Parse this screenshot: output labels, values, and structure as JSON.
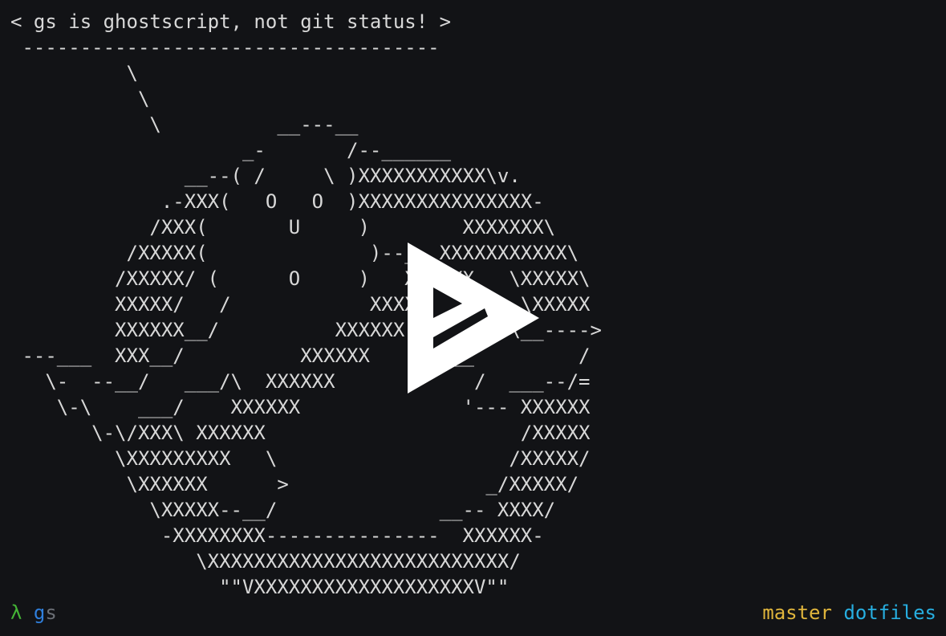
{
  "terminal": {
    "lines": [
      "< gs is ghostscript, not git status! >",
      " ------------------------------------",
      "          \\",
      "           \\",
      "            \\          __---__",
      "                    _-       /--______",
      "               __--( /     \\ )XXXXXXXXXXX\\v.",
      "             .-XXX(   O   O  )XXXXXXXXXXXXXXX-",
      "            /XXX(       U     )        XXXXXXX\\",
      "          /XXXXX(              )--_  XXXXXXXXXXX\\",
      "         /XXXXX/ (      O     )   XXXXXX   \\XXXXX\\",
      "         XXXXX/   /            XXXXXX   \\__ \\XXXXX",
      "         XXXXXX__/          XXXXXX         \\__---->",
      " ---___  XXX__/          XXXXXX      \\__         /",
      "   \\-  --__/   ___/\\  XXXXXX            /  ___--/=",
      "    \\-\\    ___/    XXXXXX              '--- XXXXXX",
      "       \\-\\/XXX\\ XXXXXX                      /XXXXX",
      "         \\XXXXXXXXX   \\                    /XXXXX/",
      "          \\XXXXXX      >                 _/XXXXX/",
      "            \\XXXXX--__/              __-- XXXX/",
      "             -XXXXXXXX---------------  XXXXXX-",
      "                \\XXXXXXXXXXXXXXXXXXXXXXXXXX/",
      "                  \"\"VXXXXXXXXXXXXXXXXXXXV\"\""
    ]
  },
  "prompt": {
    "symbol": "λ",
    "typed": "g",
    "suggestion": "s"
  },
  "status": {
    "branch": "master",
    "repo": "dotfiles"
  },
  "overlay": {
    "icon": "asciinema-play-icon",
    "color": "#ffffff"
  },
  "colors": {
    "background": "#121316",
    "text": "#d8d8d8",
    "prompt_symbol": "#44b436",
    "typed": "#2f7fdc",
    "suggestion": "#6b6f76",
    "branch": "#e0b53c",
    "repo": "#27aee0"
  }
}
